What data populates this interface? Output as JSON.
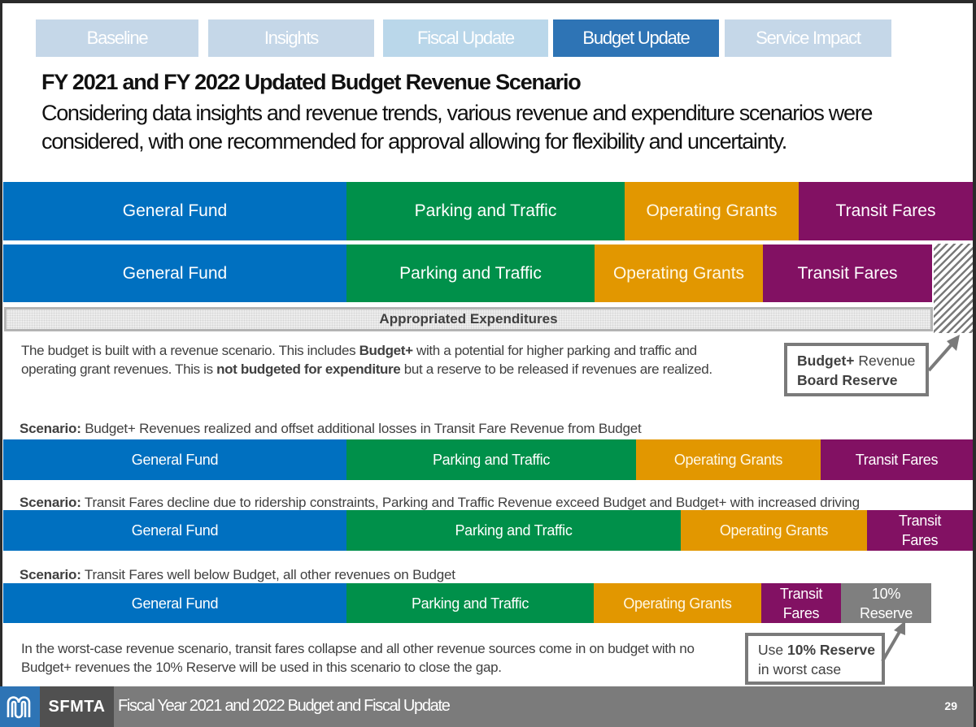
{
  "nav": {
    "tabs": [
      {
        "label": "Baseline",
        "active": false
      },
      {
        "label": "Insights",
        "active": false
      },
      {
        "label": "Fiscal Update",
        "active": false
      },
      {
        "label": "Budget Update",
        "active": true
      },
      {
        "label": "Service Impact",
        "active": false
      }
    ]
  },
  "header": {
    "title": "FY 2021 and FY 2022 Updated Budget Revenue Scenario",
    "subtitle": "Considering data insights and revenue trends, various revenue and expenditure scenarios were considered, with one recommended for approval allowing for flexibility and uncertainty."
  },
  "colors": {
    "general_fund": "#0070c0",
    "parking_traffic": "#00904a",
    "operating_grants": "#e29700",
    "transit_fares": "#821163",
    "reserve": "#7f7f7f",
    "active_tab": "#2e74b5"
  },
  "revenue_rows": {
    "budget_plus": {
      "segments": [
        "General Fund",
        "Parking and Traffic",
        "Operating Grants",
        "Transit Fares"
      ]
    },
    "budget": {
      "segments": [
        "General Fund",
        "Parking and Traffic",
        "Operating Grants",
        "Transit Fares"
      ]
    },
    "appropriated_label": "Appropriated Expenditures"
  },
  "explanation": {
    "part1": "The budget is built with a revenue scenario. This includes ",
    "bold1": "Budget+",
    "part2": " with a potential for higher parking and traffic and operating grant revenues. This is ",
    "bold2": "not budgeted for expenditure",
    "part3": " but a reserve to be released if revenues are realized."
  },
  "callout_budget_plus": {
    "bold1": "Budget+",
    "text1": " Revenue",
    "bold2": "Board Reserve"
  },
  "scenarios": [
    {
      "label": "Scenario:",
      "text": " Budget+ Revenues realized and offset additional losses in Transit Fare Revenue from Budget",
      "segments": [
        "General Fund",
        "Parking and Traffic",
        "Operating Grants",
        "Transit Fares"
      ]
    },
    {
      "label": "Scenario:",
      "text": " Transit Fares decline due to ridership constraints, Parking and Traffic Revenue exceed Budget and Budget+ with increased driving",
      "segments": [
        "General Fund",
        "Parking and Traffic",
        "Operating Grants",
        "Transit Fares"
      ]
    },
    {
      "label": "Scenario:",
      "text": " Transit Fares well below Budget, all other revenues on Budget",
      "segments": [
        "General Fund",
        "Parking and Traffic",
        "Operating Grants",
        "Transit Fares",
        "10% Reserve"
      ]
    }
  ],
  "worst_case": {
    "text": "In the worst-case revenue scenario, transit fares collapse and all other revenue sources come in on budget with no Budget+ revenues the 10% Reserve will be used in this scenario to close the gap."
  },
  "callout_reserve": {
    "text1": "Use ",
    "bold": "10% Reserve",
    "text2": "in worst case"
  },
  "footer": {
    "org": "SFMTA",
    "title": "Fiscal Year 2021 and 2022 Budget and Fiscal Update",
    "page": "29"
  }
}
